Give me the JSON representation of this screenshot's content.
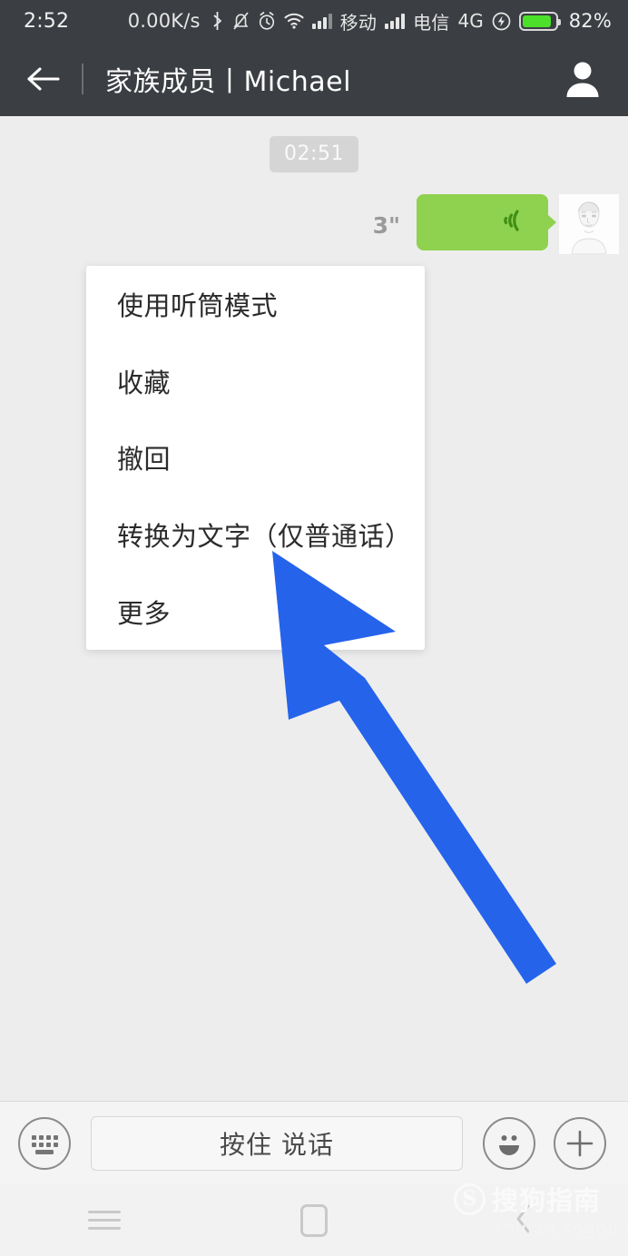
{
  "status_bar": {
    "clock": "2:52",
    "net_speed": "0.00K/s",
    "icons": [
      "bluetooth-icon",
      "mute-bell-icon",
      "alarm-clock-icon",
      "wifi-icon",
      "signal-bars-icon"
    ],
    "carrier_1": "移动",
    "carrier_2": "电信",
    "network_type": "4G",
    "charging_icon": "charging-bolt-icon",
    "battery_percent": "82%",
    "battery_level": 82,
    "bg_color": "#3b3e42",
    "battery_color": "#4ce02a"
  },
  "title_bar": {
    "back_icon": "back-arrow-icon",
    "title": "家族成员丨Michael",
    "profile_icon": "contact-profile-icon",
    "bg_color": "#3b3e42"
  },
  "chat": {
    "timestamp": "02:51",
    "message": {
      "duration": "3\"",
      "type": "voice",
      "sender": "self",
      "bubble_color": "#8fd24f",
      "wave_icon": "voice-wave-icon",
      "avatar_name": "avatar"
    }
  },
  "context_menu": {
    "items": [
      {
        "label": "使用听筒模式",
        "name": "menu-item-earpiece-mode"
      },
      {
        "label": "收藏",
        "name": "menu-item-favorite"
      },
      {
        "label": "撤回",
        "name": "menu-item-recall"
      },
      {
        "label": "转换为文字（仅普通话）",
        "name": "menu-item-convert-to-text"
      },
      {
        "label": "更多",
        "name": "menu-item-more"
      }
    ]
  },
  "annotation": {
    "arrow_color": "#2563eb",
    "points_at": "转换为文字（仅普通话）"
  },
  "input_bar": {
    "keyboard_icon": "keyboard-icon",
    "talk_button_label": "按住 说话",
    "emoji_icon": "emoji-smiley-icon",
    "plus_icon": "plus-icon"
  },
  "nav_bar": {
    "menu_icon": "nav-menu-icon",
    "home_icon": "nav-home-icon",
    "back_icon": "nav-back-icon"
  },
  "watermark": {
    "logo": "S",
    "brand": "搜狗指南",
    "url": "zhinan.sogou.com"
  }
}
